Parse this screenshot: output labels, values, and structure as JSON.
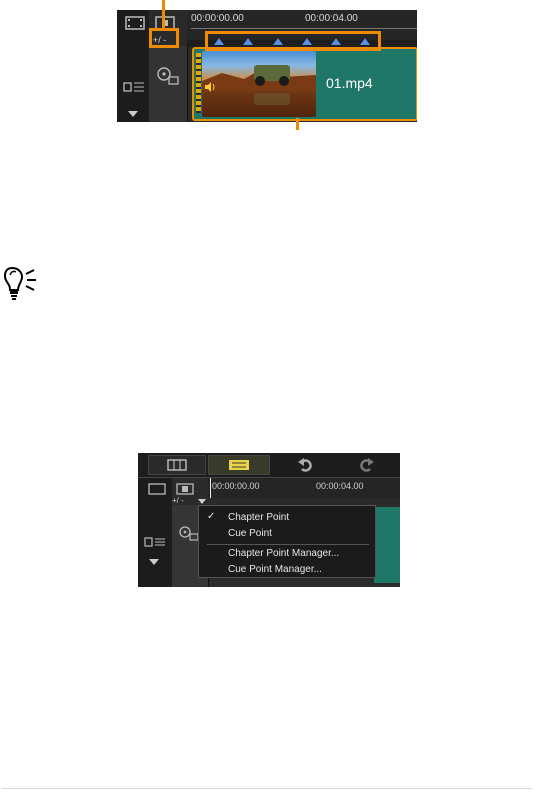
{
  "timeline_top": {
    "timecode_start": "00:00:00.00",
    "timecode_mark": "00:00:04.00",
    "marker_controls": "+/ -",
    "chapter_marker_count": 6,
    "clip_name": "01.mp4"
  },
  "timeline_bottom": {
    "timecode_start": "00:00:00.00",
    "timecode_mark": "00:00:04.00",
    "marker_controls": "+/ -",
    "menu": {
      "items": [
        {
          "label": "Chapter Point",
          "checked": true
        },
        {
          "label": "Cue Point",
          "checked": false
        },
        {
          "label": "Chapter Point Manager...",
          "checked": false
        },
        {
          "label": "Cue Point Manager...",
          "checked": false
        }
      ]
    }
  },
  "colors": {
    "callout": "#f08a00",
    "clip": "#1f7867",
    "marker": "#5a8ee6"
  }
}
